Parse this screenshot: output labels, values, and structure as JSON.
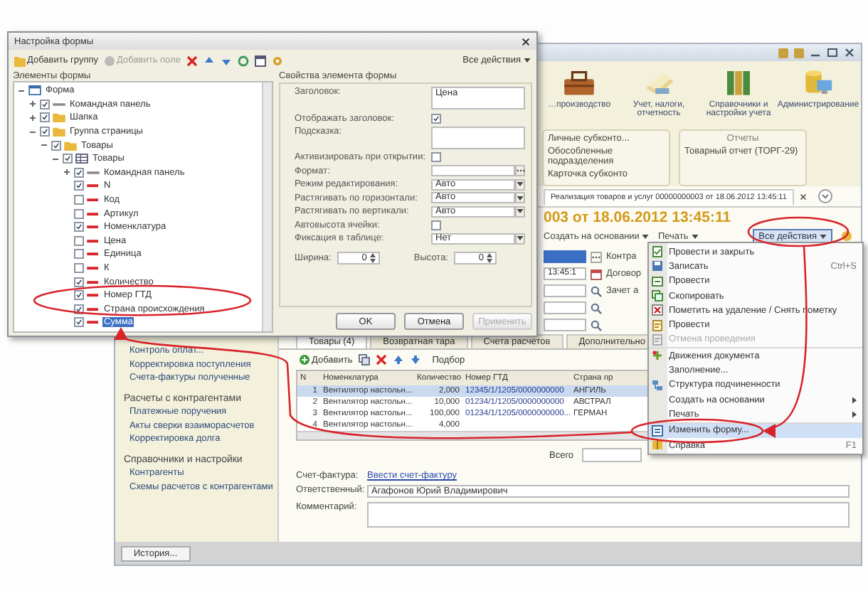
{
  "main_window": {
    "nav": [
      {
        "label": "…производство"
      },
      {
        "label": "Учет, налоги, отчетность"
      },
      {
        "label": "Справочники и настройки учета"
      },
      {
        "label": "Администрирование"
      }
    ],
    "panels": [
      {
        "items": [
          "Личные субконто...",
          "Обособленные подразделения",
          "Карточка субконто"
        ]
      },
      {
        "title": "Отчеты",
        "items": [
          "Товарный отчет (ТОРГ-29)"
        ]
      }
    ],
    "sidebar": {
      "groups": [
        {
          "items": [
            "Контроль оплат...",
            "Корректировка поступления",
            "Счета-фактуры полученные"
          ]
        },
        {
          "title": "Расчеты с контрагентами",
          "items": [
            "Платежные поручения",
            "Акты сверки взаиморасчетов",
            "Корректировка долга"
          ]
        },
        {
          "title": "Справочники и настройки",
          "items": [
            "Контрагенты",
            "Схемы расчетов с контрагентами"
          ]
        }
      ]
    },
    "document": {
      "tab": "Реализация товаров и услуг 00000000003 от 18.06.2012 13:45:11",
      "heading": "003 от 18.06.2012 13:45:11",
      "toolbar": [
        "Создать на основании",
        "Печать"
      ],
      "all_actions": "Все действия",
      "fields": [
        {
          "kind": "selected",
          "label": "Контра"
        },
        {
          "kind": "date",
          "value": "13:45:1",
          "label": "Договор"
        },
        {
          "kind": "search",
          "label": "Зачет а"
        },
        {
          "kind": "search"
        },
        {
          "kind": "search"
        }
      ],
      "tabs": [
        {
          "label": "Товары (4)",
          "selected": true
        },
        {
          "label": "Возвратная тара",
          "selected": false
        },
        {
          "label": "Счета расчетов",
          "selected": false
        },
        {
          "label": "Дополнительно",
          "selected": false
        }
      ],
      "table_toolbar": {
        "add": "Добавить",
        "pick": "Подбор"
      },
      "table": {
        "columns": [
          "N",
          "Номенклатура",
          "Количество",
          "Номер ГТД",
          "Страна пр"
        ],
        "rows": [
          {
            "cells": [
              "1",
              "Вентилятор настольн...",
              "2,000",
              "12345/1/1205/0000000000",
              "АНГИЛЬ"
            ],
            "selected": true
          },
          {
            "cells": [
              "2",
              "Вентилятор настольн...",
              "10,000",
              "01234/1/1205/0000000000",
              "АВСТРАЛ"
            ],
            "selected": false
          },
          {
            "cells": [
              "3",
              "Вентилятор настольн...",
              "100,000",
              "01234/1/1205/0000000000...",
              "ГЕРМАН"
            ],
            "selected": false
          },
          {
            "cells": [
              "4",
              "Вентилятор настольн...",
              "4,000",
              "",
              ""
            ],
            "selected": false
          }
        ]
      },
      "total_label": "Всего",
      "invoice": {
        "label": "Счет-фактура:",
        "link": "Ввести счет-фактуру"
      },
      "responsible": {
        "label": "Ответственный:",
        "value": "Агафонов Юрий Владимирович"
      },
      "comment": {
        "label": "Комментарий:"
      }
    },
    "taskbar": {
      "button": "История..."
    }
  },
  "dialog": {
    "title": "Настройка формы",
    "add_group": "Добавить группу",
    "add_field": "Добавить поле",
    "all_actions": "Все действия",
    "elements_title": "Элементы формы",
    "properties_title": "Свойства элемента формы",
    "tree": [
      {
        "label": "Форма",
        "kind": "form",
        "expanded": true,
        "children": [
          {
            "label": "Командная панель",
            "kind": "panel",
            "expanded": false,
            "checked": true
          },
          {
            "label": "Шапка",
            "kind": "folder",
            "expanded": false,
            "checked": true
          },
          {
            "label": "Группа страницы",
            "kind": "folder",
            "expanded": true,
            "checked": true,
            "children": [
              {
                "label": "Товары",
                "kind": "folder",
                "expanded": true,
                "checked": true,
                "children": [
                  {
                    "label": "Товары",
                    "kind": "table",
                    "expanded": true,
                    "checked": true,
                    "children": [
                      {
                        "label": "Командная панель",
                        "kind": "panel",
                        "expanded": false,
                        "checked": true
                      },
                      {
                        "label": "N",
                        "kind": "field",
                        "checked": true,
                        "selected": false
                      },
                      {
                        "label": "Код",
                        "kind": "field",
                        "checked": false,
                        "selected": false
                      },
                      {
                        "label": "Артикул",
                        "kind": "field",
                        "checked": false,
                        "selected": false
                      },
                      {
                        "label": "Номенклатура",
                        "kind": "field",
                        "checked": true,
                        "selected": false
                      },
                      {
                        "label": "Цена",
                        "kind": "field",
                        "checked": false,
                        "selected": false
                      },
                      {
                        "label": "Единица",
                        "kind": "field",
                        "checked": false,
                        "selected": false
                      },
                      {
                        "label": "К",
                        "kind": "field",
                        "checked": false,
                        "selected": false
                      },
                      {
                        "label": "Количество",
                        "kind": "field",
                        "checked": true,
                        "selected": false
                      },
                      {
                        "label": "Номер ГТД",
                        "kind": "field",
                        "checked": true,
                        "selected": false
                      },
                      {
                        "label": "Страна происхождения",
                        "kind": "field",
                        "checked": true,
                        "selected": false
                      },
                      {
                        "label": "Сумма",
                        "kind": "field",
                        "checked": true,
                        "selected": true
                      }
                    ]
                  }
                ]
              }
            ]
          }
        ]
      }
    ],
    "properties": [
      {
        "label": "Заголовок:",
        "kind": "textarea",
        "value": "Цена"
      },
      {
        "label": "Отображать заголовок:",
        "kind": "checkbox",
        "checked": true
      },
      {
        "label": "Подсказка:",
        "kind": "textarea"
      },
      {
        "label": "Активизировать при открытии:",
        "kind": "checkbox",
        "checked": false
      },
      {
        "label": "Формат:",
        "kind": "field"
      },
      {
        "label": "Режим редактирования:",
        "kind": "select",
        "value": "Авто"
      },
      {
        "label": "Растягивать по горизонтали:",
        "kind": "select",
        "value": "Авто"
      },
      {
        "label": "Растягивать по вертикали:",
        "kind": "select",
        "value": "Авто"
      },
      {
        "label": "Автовысота ячейки:",
        "kind": "checkbox",
        "checked": false
      },
      {
        "label": "Фиксация в таблице:",
        "kind": "select",
        "value": "Нет"
      }
    ],
    "sizes": [
      {
        "label": "Ширина:",
        "value": "0"
      },
      {
        "label": "Высота:",
        "value": "0"
      }
    ],
    "buttons": [
      {
        "label": "OK",
        "disabled": false
      },
      {
        "label": "Отмена",
        "disabled": false
      },
      {
        "label": "Применить",
        "disabled": true
      }
    ]
  },
  "context_menu": {
    "items": [
      {
        "label": "Провести и закрыть",
        "selected": false,
        "disabled": false
      },
      {
        "label": "Записать",
        "shortcut": "Ctrl+S",
        "selected": false,
        "disabled": false
      },
      {
        "label": "Провести",
        "selected": false,
        "disabled": false
      },
      {
        "label": "Скопировать",
        "selected": false,
        "disabled": false
      },
      {
        "label": "Пометить на удаление / Снять пометку",
        "selected": false,
        "disabled": false
      },
      {
        "label": "Провести",
        "selected": false,
        "disabled": false
      },
      {
        "label": "Отмена проведения",
        "selected": false,
        "disabled": true,
        "separator": true
      },
      {
        "label": "Движения документа",
        "selected": false,
        "disabled": false
      },
      {
        "label": "Заполнение...",
        "selected": false,
        "disabled": false
      },
      {
        "label": "Структура подчиненности",
        "selected": false,
        "disabled": false
      },
      {
        "label": "Создать на основании",
        "submenu": true,
        "selected": false,
        "disabled": false
      },
      {
        "label": "Печать",
        "submenu": true,
        "selected": false,
        "disabled": false,
        "separator": true
      },
      {
        "label": "Изменить форму...",
        "selected": true,
        "disabled": false
      },
      {
        "label": "Справка",
        "shortcut": "F1",
        "selected": false,
        "disabled": false
      }
    ]
  }
}
